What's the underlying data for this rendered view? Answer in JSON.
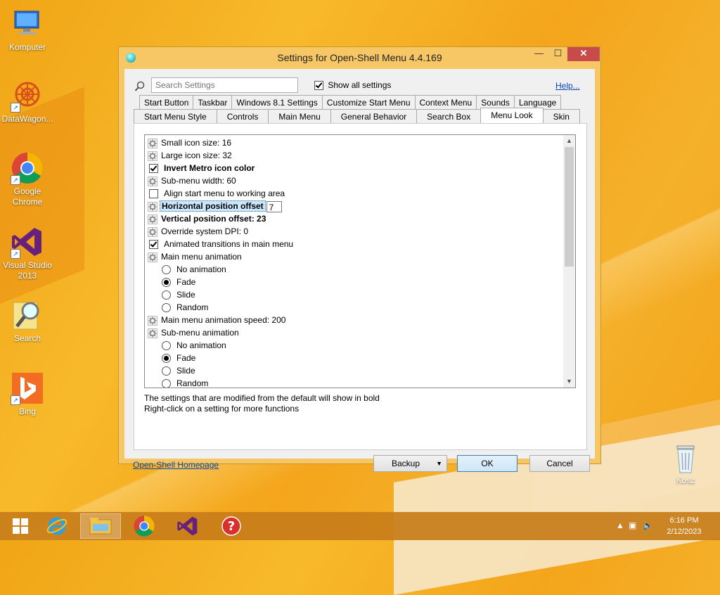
{
  "desktop": {
    "icons": [
      {
        "label": "Komputer"
      },
      {
        "label": "DataWagon..."
      },
      {
        "label": "Google Chrome"
      },
      {
        "label": "Visual Studio 2013"
      },
      {
        "label": "Search"
      },
      {
        "label": "Bing"
      },
      {
        "label": "Kosz"
      }
    ]
  },
  "window": {
    "title": "Settings for Open-Shell Menu 4.4.169",
    "controls": {
      "minimize": "—",
      "maximize": "☐",
      "close": "✕"
    }
  },
  "search": {
    "placeholder": "Search Settings",
    "value": ""
  },
  "show_all": {
    "label": "Show all settings",
    "checked": true
  },
  "help_link": "Help...",
  "tabs": {
    "row1": [
      "Start Button",
      "Taskbar",
      "Windows 8.1 Settings",
      "Customize Start Menu",
      "Context Menu",
      "Sounds",
      "Language"
    ],
    "row2": [
      "Start Menu Style",
      "Controls",
      "Main Menu",
      "General Behavior",
      "Search Box",
      "Menu Look",
      "Skin"
    ],
    "active": "Menu Look"
  },
  "settings": [
    {
      "type": "gear",
      "label": "Small icon size: 16"
    },
    {
      "type": "gear",
      "label": "Large icon size: 32"
    },
    {
      "type": "check",
      "checked": true,
      "bold": true,
      "label": "Invert Metro icon color"
    },
    {
      "type": "gear",
      "label": "Sub-menu width: 60"
    },
    {
      "type": "check",
      "checked": false,
      "label": "Align start menu to working area"
    },
    {
      "type": "gear",
      "bold": true,
      "selected": true,
      "label": "Horizontal position offset",
      "edit_value": "7"
    },
    {
      "type": "gear",
      "bold": true,
      "label": "Vertical position offset: 23"
    },
    {
      "type": "gear",
      "label": "Override system DPI: 0"
    },
    {
      "type": "check",
      "checked": true,
      "label": "Animated transitions in main menu"
    },
    {
      "type": "gear",
      "label": "Main menu animation"
    },
    {
      "type": "radio",
      "on": false,
      "label": "No animation"
    },
    {
      "type": "radio",
      "on": true,
      "label": "Fade"
    },
    {
      "type": "radio",
      "on": false,
      "label": "Slide"
    },
    {
      "type": "radio",
      "on": false,
      "label": "Random"
    },
    {
      "type": "gear",
      "label": "Main menu animation speed: 200"
    },
    {
      "type": "gear",
      "label": "Sub-menu animation"
    },
    {
      "type": "radio",
      "on": false,
      "label": "No animation"
    },
    {
      "type": "radio",
      "on": true,
      "label": "Fade"
    },
    {
      "type": "radio",
      "on": false,
      "label": "Slide"
    },
    {
      "type": "radio",
      "on": false,
      "label": "Random"
    }
  ],
  "notes": {
    "line1": "The settings that are modified from the default will show in bold",
    "line2": "Right-click on a setting for more functions"
  },
  "footer": {
    "homepage": "Open-Shell Homepage",
    "backup": "Backup",
    "ok": "OK",
    "cancel": "Cancel"
  },
  "taskbar": {
    "time": "6:16 PM",
    "date": "2/12/2023"
  },
  "colors": {
    "accent": "#f2a216",
    "close": "#c74b4b",
    "link": "#0645ad"
  }
}
